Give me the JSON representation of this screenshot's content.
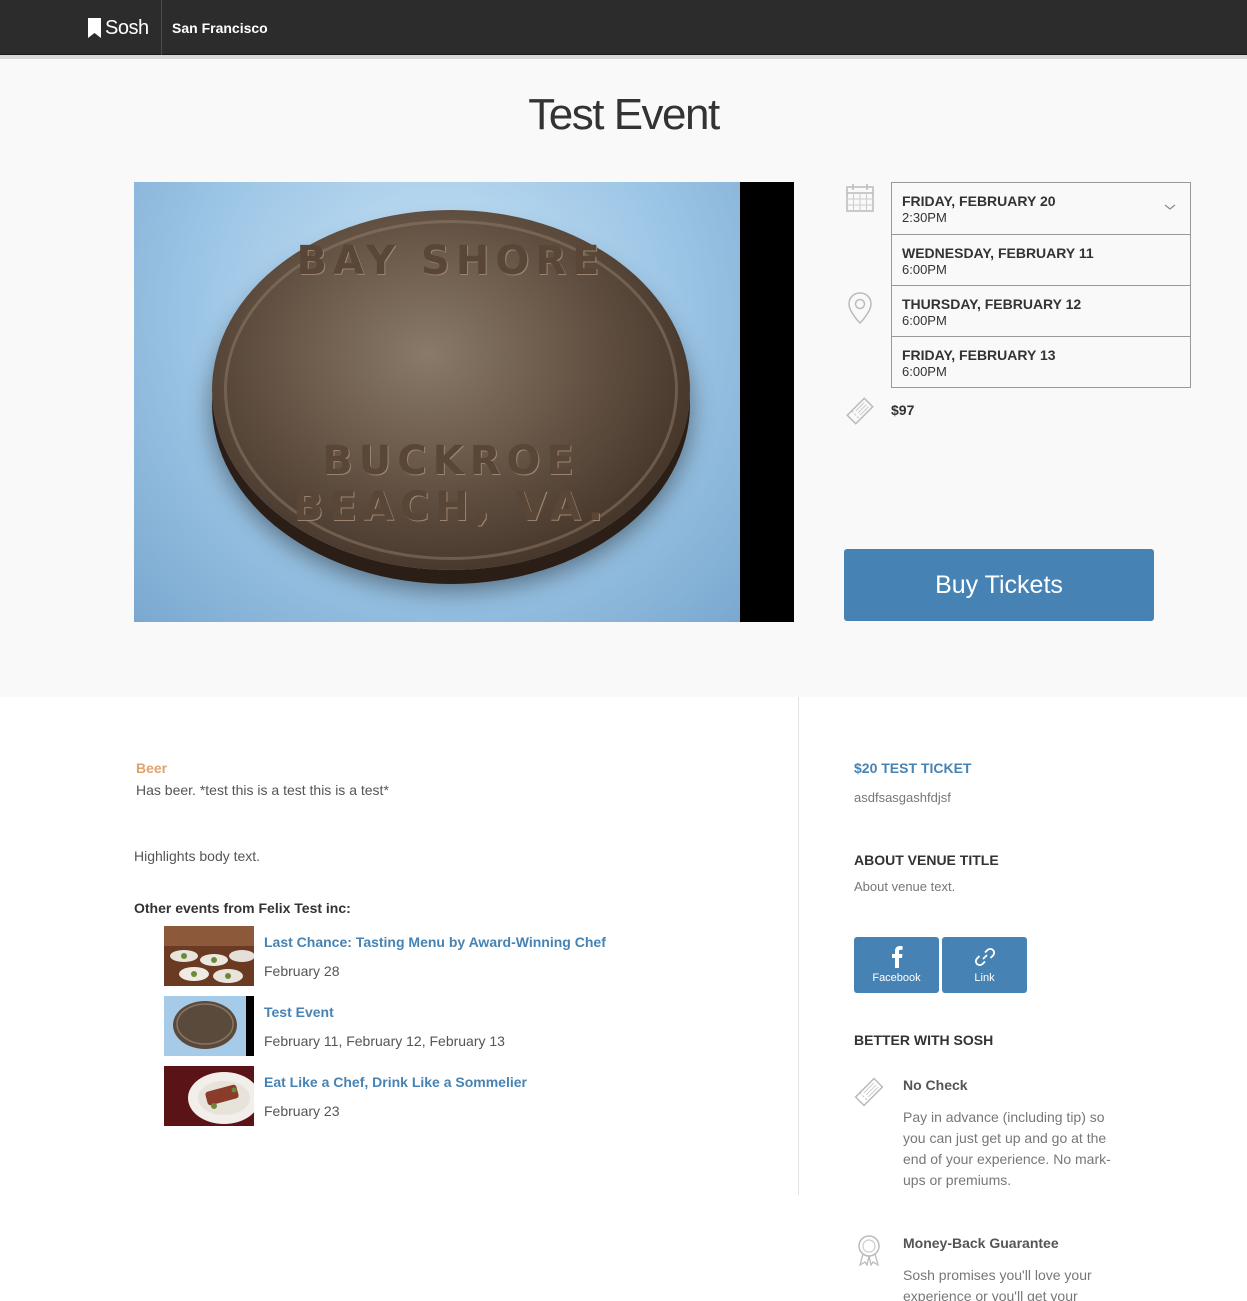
{
  "header": {
    "logo_text": "Sosh",
    "city": "San Francisco"
  },
  "event": {
    "title": "Test Event",
    "dates": [
      {
        "day": "FRIDAY, FEBRUARY 20",
        "time": "2:30PM"
      },
      {
        "day": "WEDNESDAY, FEBRUARY 11",
        "time": "6:00PM"
      },
      {
        "day": "THURSDAY, FEBRUARY 12",
        "time": "6:00PM"
      },
      {
        "day": "FRIDAY, FEBRUARY 13",
        "time": "6:00PM"
      }
    ],
    "price": "$97",
    "buy_label": "Buy Tickets",
    "coin_text_top": "BAY SHORE",
    "coin_text_bottom": "BUCKROE BEACH, VA."
  },
  "details": {
    "beer_title": "Beer",
    "beer_text": "Has beer. *test this is a test this is a test*",
    "highlights": "Highlights body text.",
    "other_title": "Other events from Felix Test inc:",
    "other_events": [
      {
        "name": "Last Chance: Tasting Menu by Award-Winning Chef",
        "date": "February 28"
      },
      {
        "name": "Test Event",
        "date": "February 11, February 12, February 13"
      },
      {
        "name": "Eat Like a Chef, Drink Like a Sommelier",
        "date": "February 23"
      }
    ]
  },
  "sidebar": {
    "ticket_title": "$20 TEST TICKET",
    "ticket_desc": "asdfsasgashfdjsf",
    "venue_title": "ABOUT VENUE TITLE",
    "venue_text": "About venue text.",
    "share_facebook": "Facebook",
    "share_link": "Link",
    "better_title": "BETTER WITH SOSH",
    "perks": [
      {
        "title": "No Check",
        "text": "Pay in advance (including tip) so you can just get up and go at the end of your experience. No mark-ups or premiums."
      },
      {
        "title": "Money-Back Guarantee",
        "text": "Sosh promises you'll love your experience or you'll get your"
      }
    ]
  },
  "colors": {
    "accent": "#4683b4",
    "highlight": "#e0a36a",
    "topbar": "#2c2c2c"
  }
}
